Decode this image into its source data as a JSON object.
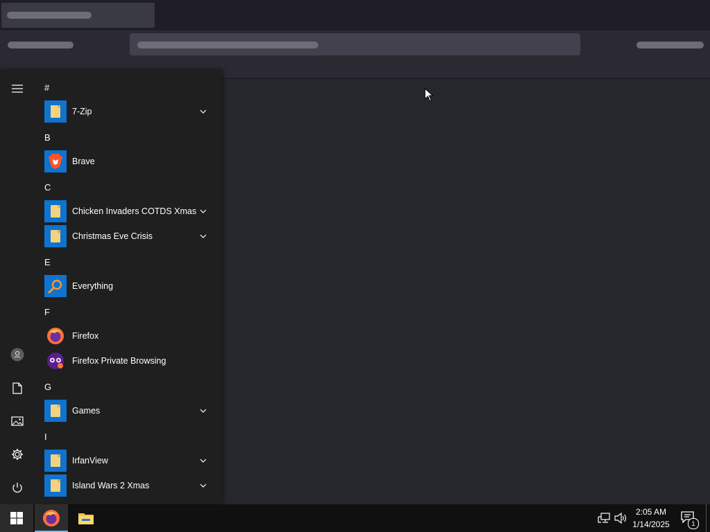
{
  "start_menu": {
    "groups": [
      {
        "letter": "#",
        "apps": [
          {
            "label": "7-Zip",
            "expandable": true
          }
        ]
      },
      {
        "letter": "B",
        "apps": [
          {
            "label": "Brave",
            "expandable": false
          }
        ]
      },
      {
        "letter": "C",
        "apps": [
          {
            "label": "Chicken Invaders COTDS Xmas",
            "expandable": true
          },
          {
            "label": "Christmas Eve Crisis",
            "expandable": true
          }
        ]
      },
      {
        "letter": "E",
        "apps": [
          {
            "label": "Everything",
            "expandable": false
          }
        ]
      },
      {
        "letter": "F",
        "apps": [
          {
            "label": "Firefox",
            "expandable": false
          },
          {
            "label": "Firefox Private Browsing",
            "expandable": false
          }
        ]
      },
      {
        "letter": "G",
        "apps": [
          {
            "label": "Games",
            "expandable": true
          }
        ]
      },
      {
        "letter": "I",
        "apps": [
          {
            "label": "IrfanView",
            "expandable": true
          },
          {
            "label": "Island Wars 2 Xmas",
            "expandable": true
          }
        ]
      }
    ],
    "rail_icons": [
      "hamburger-icon",
      "user-icon",
      "documents-icon",
      "pictures-icon",
      "settings-icon",
      "power-icon"
    ]
  },
  "taskbar": {
    "apps": [
      "firefox-icon",
      "file-explorer-icon"
    ],
    "tray_icons": [
      "network-icon",
      "volume-icon"
    ],
    "clock": {
      "time": "2:05 AM",
      "date": "1/14/2025"
    },
    "notification_count": "1"
  },
  "colors": {
    "tile_blue": "#0f73d0",
    "menu_bg": "#1f1f1f",
    "taskbar_bg": "#101010",
    "accent_underline": "#76b9ed"
  }
}
